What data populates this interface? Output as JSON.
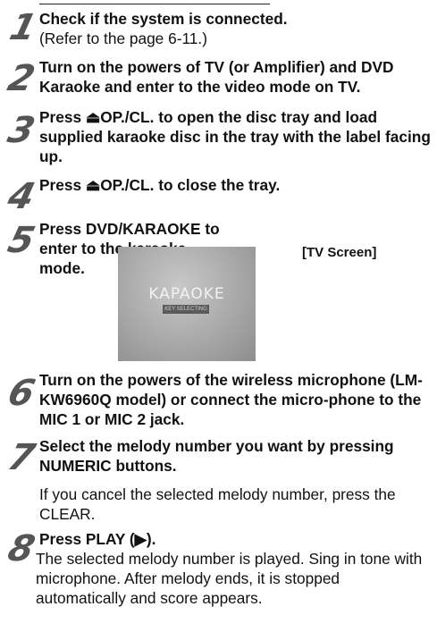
{
  "steps": [
    {
      "num": "1",
      "bold": "Check if the system is connected.",
      "plain": "(Refer to the page 6-11.)"
    },
    {
      "num": "2",
      "bold": "Turn on the powers of TV (or Amplifier) and DVD Karaoke and enter to the video mode on TV."
    },
    {
      "num": "3",
      "bold": "Press ⏏OP./CL. to open the disc tray and load supplied karaoke disc in the tray with the label facing up."
    },
    {
      "num": "4",
      "bold": "Press ⏏OP./CL. to close the tray."
    },
    {
      "num": "5",
      "bold": "Press DVD/KARAOKE to enter to the karaoke mode."
    },
    {
      "num": "6",
      "bold": "Turn on the powers of the wireless microphone (LM-KW6960Q model) or connect the micro-phone to the MIC 1 or MIC 2 jack."
    },
    {
      "num": "7",
      "bold": "Select the melody number you want by pressing NUMERIC buttons.",
      "plain": "If you cancel the selected melody number, press the CLEAR."
    },
    {
      "num": "8",
      "bold": "Press PLAY (▶).",
      "plain": "The selected melody number is played. Sing in tone with microphone. After melody ends, it is stopped automatically and score appears."
    }
  ],
  "tv_screen": {
    "label": "[TV Screen]",
    "title": "KAPAOKE",
    "subtitle": "KEY SELECTING"
  }
}
